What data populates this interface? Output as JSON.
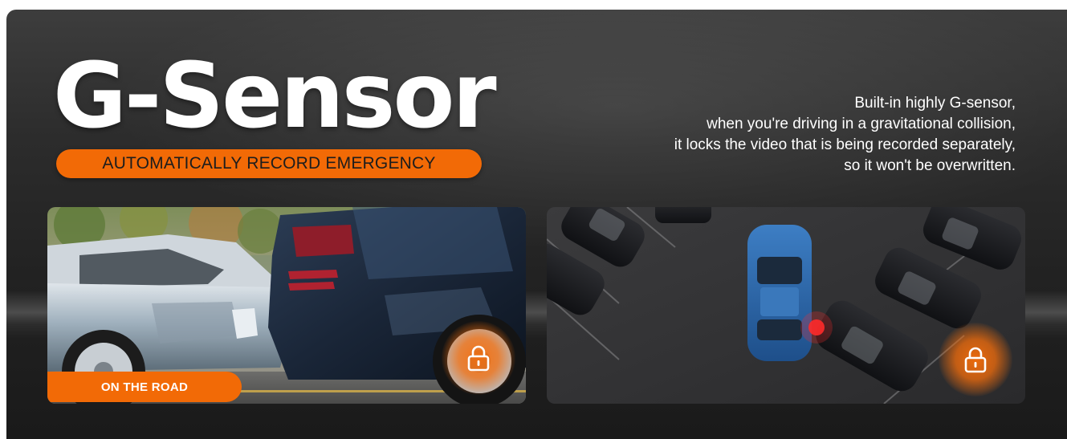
{
  "headline": {
    "title": "G-Sensor",
    "subtitle": "AUTOMATICALLY RECORD EMERGENCY"
  },
  "description": {
    "lines": [
      "Built-in highly G-sensor,",
      "when you're driving in a gravitational collision,",
      "it locks the video that is being recorded separately,",
      "so it won't be overwritten."
    ]
  },
  "panels": [
    {
      "scene": "car-collision-photo",
      "label": "ON THE ROAD",
      "badge_icon": "lock-icon"
    },
    {
      "scene": "parking-lot-overhead",
      "badge_icon": "lock-icon"
    }
  ],
  "colors": {
    "accent": "#f26a06",
    "background": "#2a2a2a",
    "text": "#ffffff"
  }
}
